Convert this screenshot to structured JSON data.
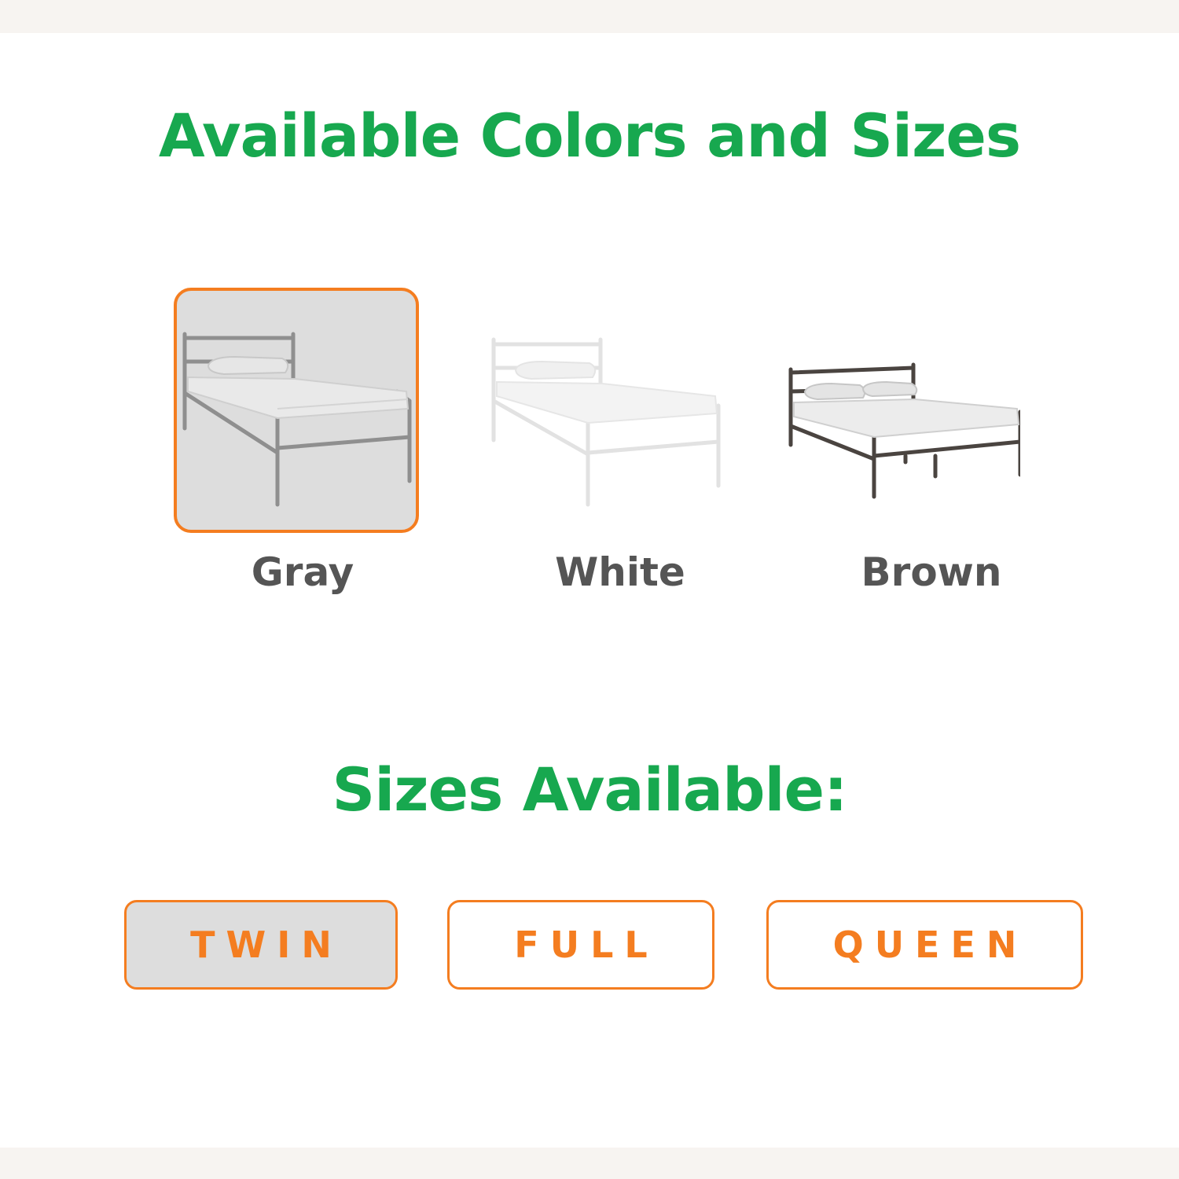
{
  "colors_section": {
    "title": "Available Colors and Sizes",
    "options": [
      {
        "label": "Gray",
        "selected": true,
        "frame_color": "#8f8f8f"
      },
      {
        "label": "White",
        "selected": false,
        "frame_color": "#e2e2e2"
      },
      {
        "label": "Brown",
        "selected": false,
        "frame_color": "#4a4440"
      }
    ]
  },
  "sizes_section": {
    "title": "Sizes Available:",
    "options": [
      {
        "label": "TWIN",
        "selected": true
      },
      {
        "label": "FULL",
        "selected": false
      },
      {
        "label": "QUEEN",
        "selected": false
      }
    ]
  },
  "theme": {
    "heading_color": "#17a84f",
    "accent_color": "#f47d20",
    "label_color": "#555555",
    "selected_bg": "#dddddd"
  }
}
